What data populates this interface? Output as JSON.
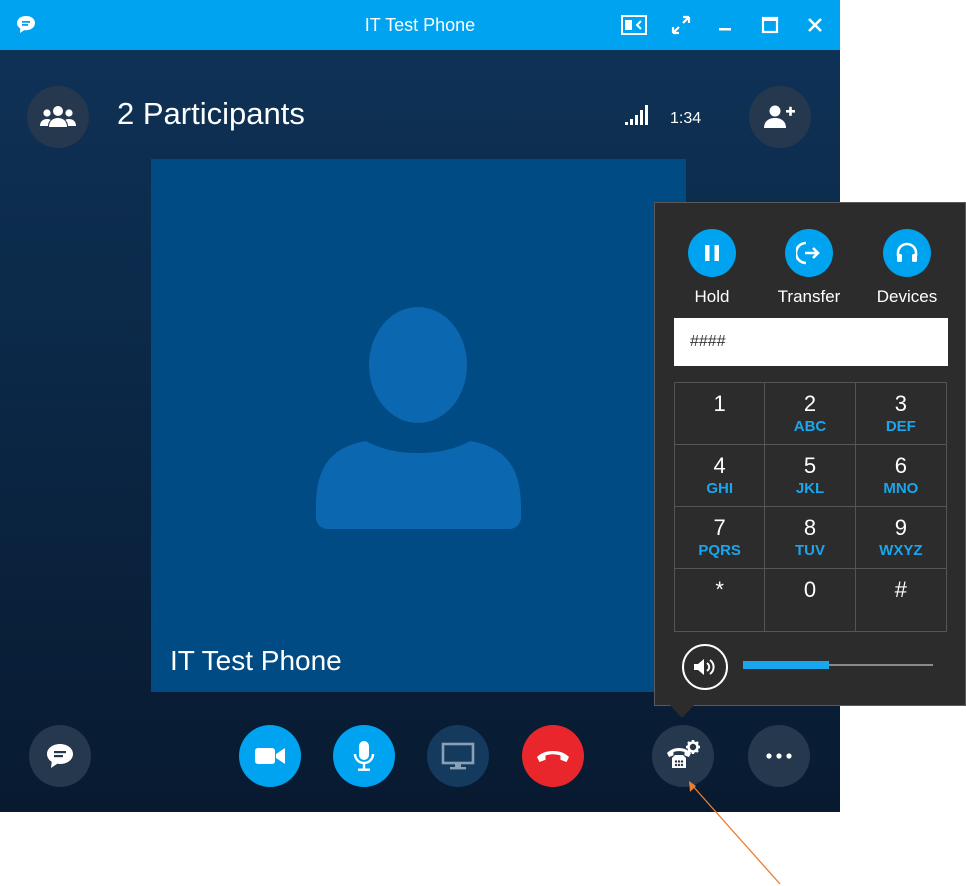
{
  "window": {
    "title": "IT Test Phone",
    "accent_color": "#00a3f0",
    "titlebar_icons": [
      "chat-app-icon",
      "contact-card-icon",
      "fullscreen-icon",
      "minimize-icon",
      "maximize-icon",
      "close-icon"
    ]
  },
  "header": {
    "participants_label": "2 Participants",
    "call_timer": "1:34"
  },
  "stage": {
    "caller_name": "IT Test Phone"
  },
  "dialpad": {
    "actions": [
      {
        "label": "Hold",
        "icon": "pause-icon"
      },
      {
        "label": "Transfer",
        "icon": "transfer-icon"
      },
      {
        "label": "Devices",
        "icon": "headset-icon"
      }
    ],
    "input_value": "####",
    "keys": [
      {
        "digit": "1",
        "letters": ""
      },
      {
        "digit": "2",
        "letters": "ABC"
      },
      {
        "digit": "3",
        "letters": "DEF"
      },
      {
        "digit": "4",
        "letters": "GHI"
      },
      {
        "digit": "5",
        "letters": "JKL"
      },
      {
        "digit": "6",
        "letters": "MNO"
      },
      {
        "digit": "7",
        "letters": "PQRS"
      },
      {
        "digit": "8",
        "letters": "TUV"
      },
      {
        "digit": "9",
        "letters": "WXYZ"
      },
      {
        "digit": "*",
        "letters": ""
      },
      {
        "digit": "0",
        "letters": ""
      },
      {
        "digit": "#",
        "letters": ""
      }
    ],
    "volume_level_fraction": 0.45
  },
  "toolbar": {
    "buttons": [
      "chat-icon",
      "video-icon",
      "microphone-icon",
      "screen-share-icon",
      "hang-up-icon",
      "call-controls-icon",
      "more-options-icon"
    ],
    "colors": {
      "video": "#00a3f0",
      "mic": "#00a3f0",
      "hangup": "#e8262b",
      "dark": "#26384e"
    }
  }
}
